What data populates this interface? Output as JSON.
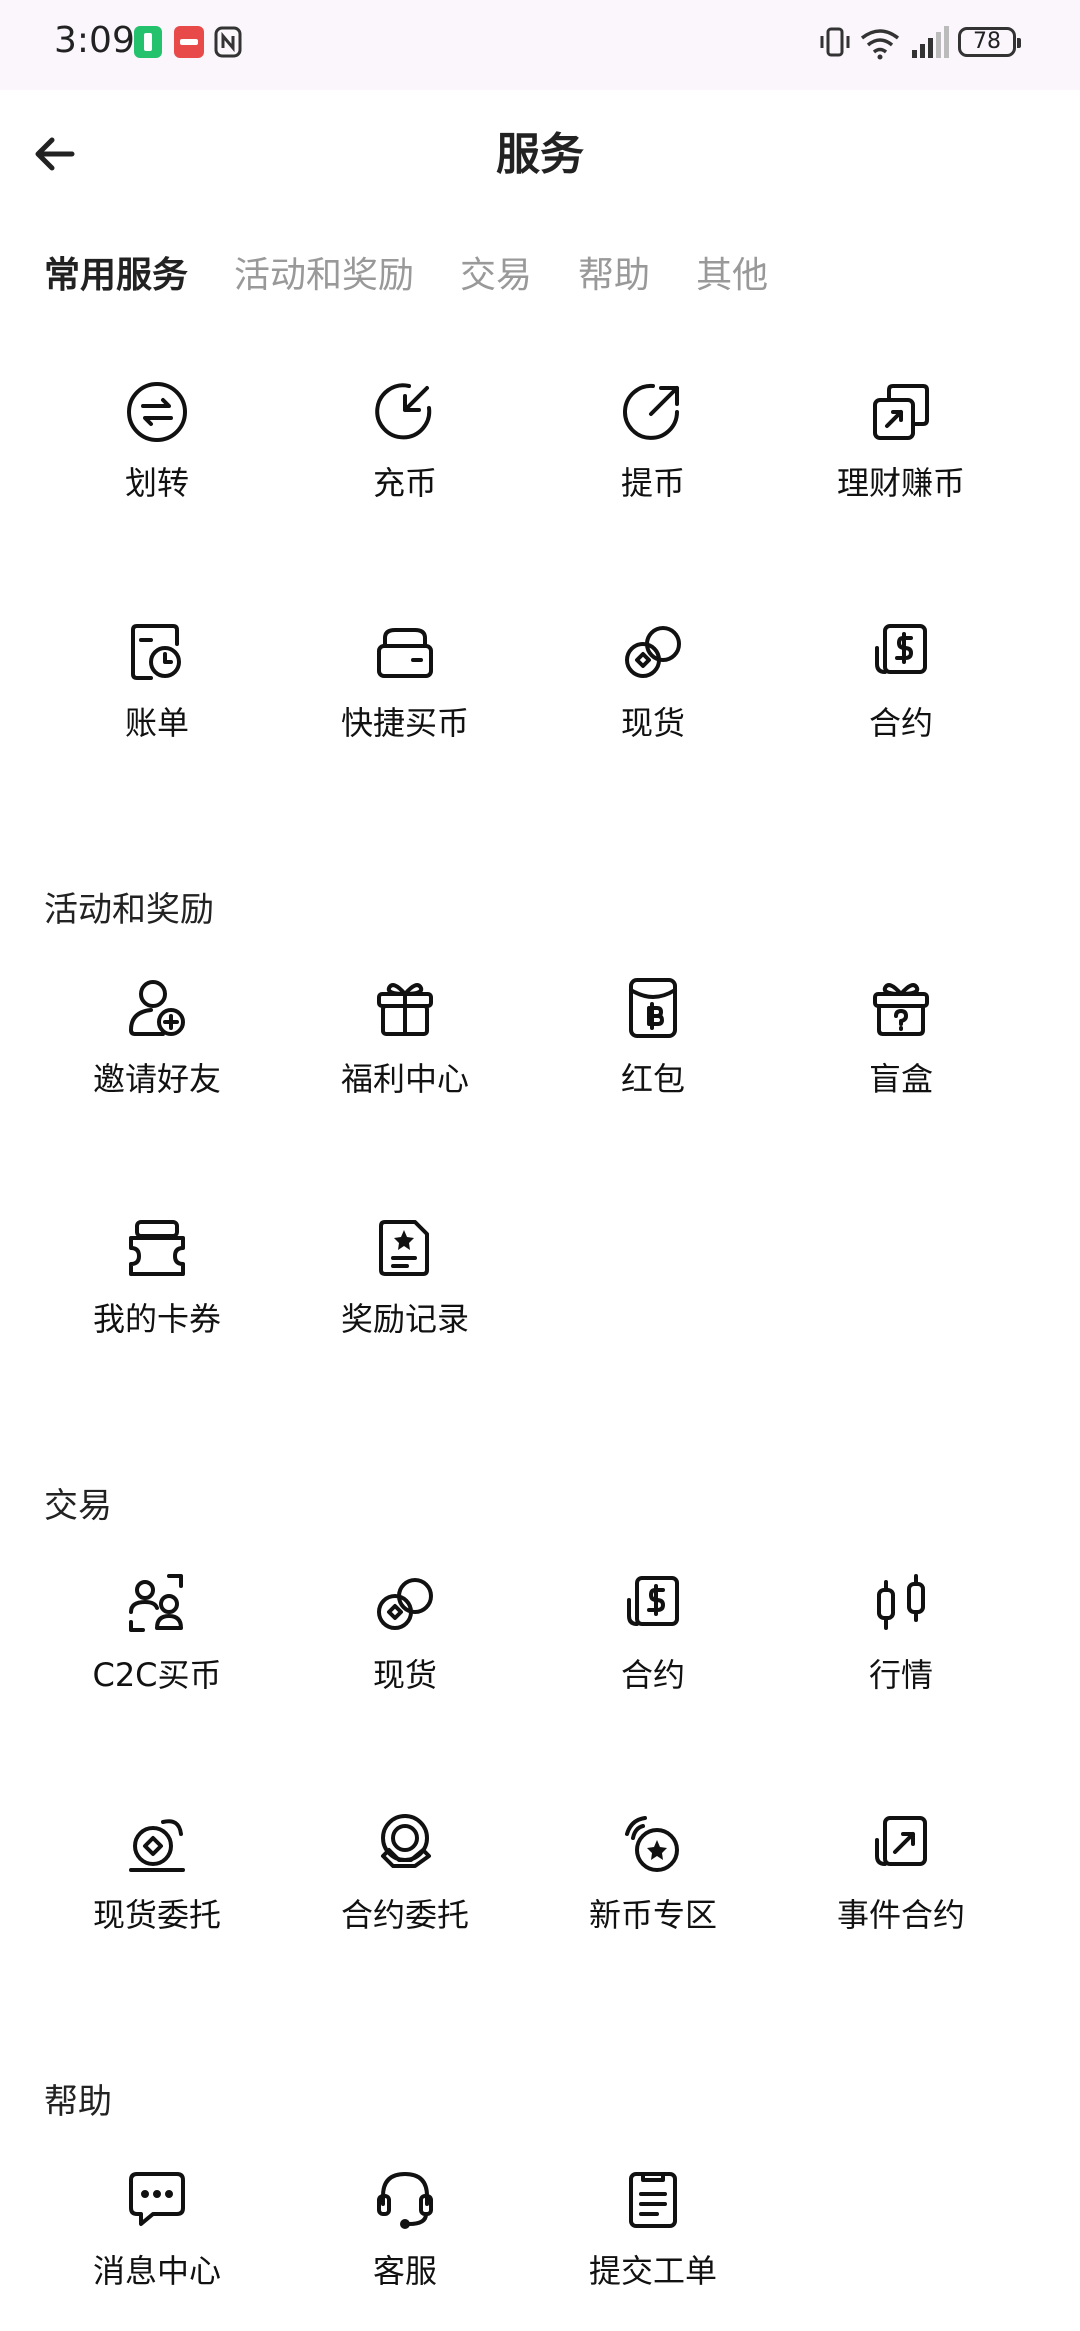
{
  "status_bar": {
    "time": "3:09",
    "battery": "78"
  },
  "header": {
    "title": "服务"
  },
  "tabs": [
    {
      "label": "常用服务",
      "active": true
    },
    {
      "label": "活动和奖励",
      "active": false
    },
    {
      "label": "交易",
      "active": false
    },
    {
      "label": "帮助",
      "active": false
    },
    {
      "label": "其他",
      "active": false
    }
  ],
  "sections": {
    "common": {
      "items": [
        {
          "label": "划转",
          "icon": "transfer-icon"
        },
        {
          "label": "充币",
          "icon": "deposit-icon"
        },
        {
          "label": "提币",
          "icon": "withdraw-icon"
        },
        {
          "label": "理财赚币",
          "icon": "earn-icon"
        },
        {
          "label": "账单",
          "icon": "bill-icon"
        },
        {
          "label": "快捷买币",
          "icon": "quick-buy-icon"
        },
        {
          "label": "现货",
          "icon": "spot-icon"
        },
        {
          "label": "合约",
          "icon": "futures-icon"
        }
      ]
    },
    "activities": {
      "title": "活动和奖励",
      "items": [
        {
          "label": "邀请好友",
          "icon": "invite-friend-icon"
        },
        {
          "label": "福利中心",
          "icon": "gift-icon"
        },
        {
          "label": "红包",
          "icon": "red-packet-icon"
        },
        {
          "label": "盲盒",
          "icon": "mystery-box-icon"
        },
        {
          "label": "我的卡券",
          "icon": "coupon-icon"
        },
        {
          "label": "奖励记录",
          "icon": "reward-record-icon"
        }
      ]
    },
    "trade": {
      "title": "交易",
      "items": [
        {
          "label": "C2C买币",
          "icon": "c2c-icon"
        },
        {
          "label": "现货",
          "icon": "spot-icon"
        },
        {
          "label": "合约",
          "icon": "futures-icon"
        },
        {
          "label": "行情",
          "icon": "market-icon"
        },
        {
          "label": "现货委托",
          "icon": "spot-order-icon"
        },
        {
          "label": "合约委托",
          "icon": "futures-order-icon"
        },
        {
          "label": "新币专区",
          "icon": "new-coin-icon"
        },
        {
          "label": "事件合约",
          "icon": "event-contract-icon"
        }
      ]
    },
    "help": {
      "title": "帮助",
      "items": [
        {
          "label": "消息中心",
          "icon": "message-icon"
        },
        {
          "label": "客服",
          "icon": "support-icon"
        },
        {
          "label": "提交工单",
          "icon": "ticket-icon"
        }
      ]
    }
  }
}
